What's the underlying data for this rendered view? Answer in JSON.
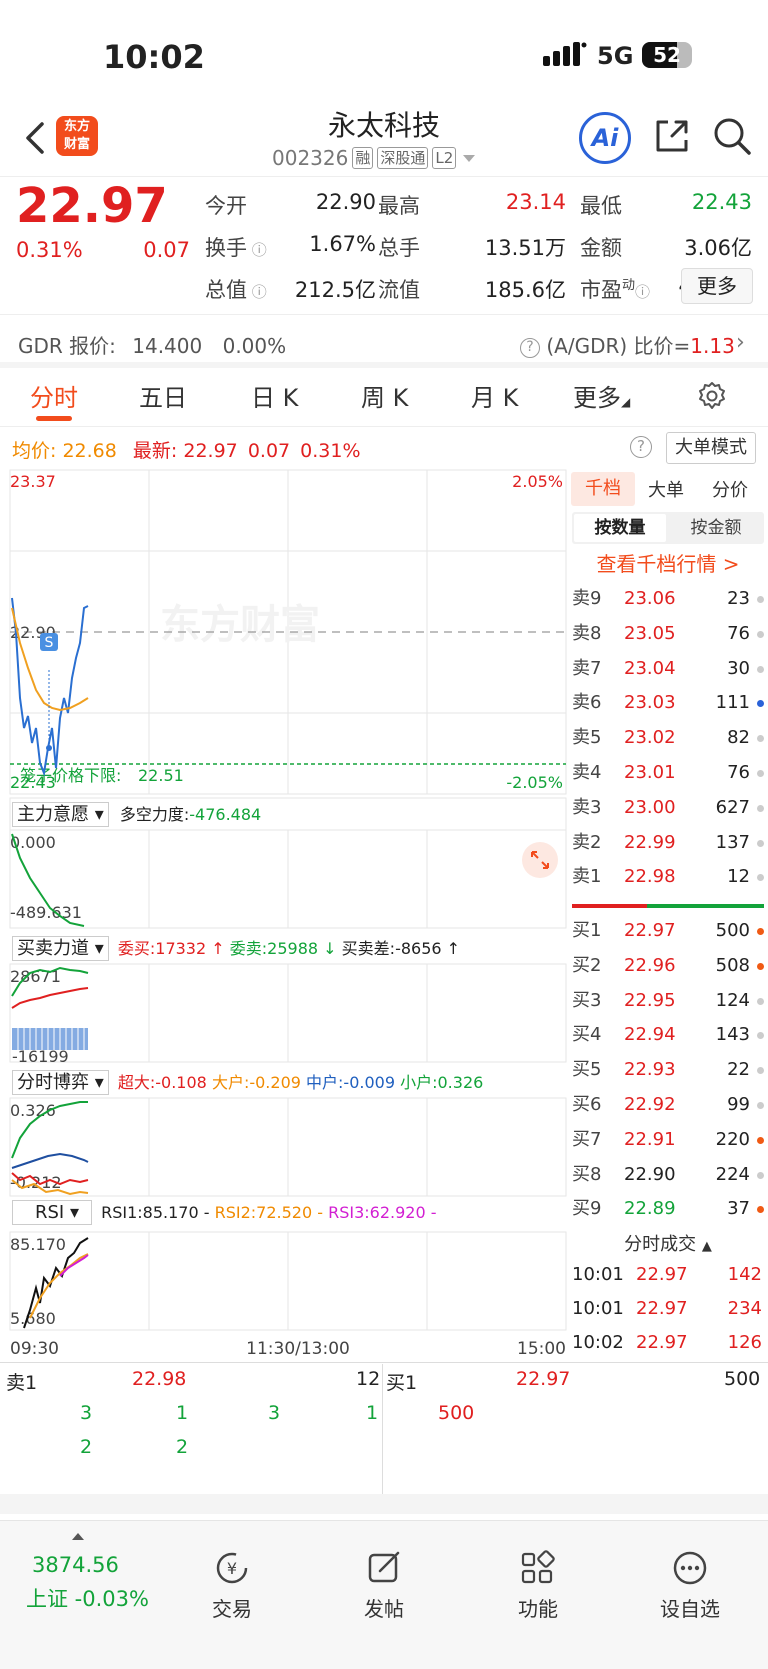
{
  "status": {
    "time": "10:02",
    "network": "5G",
    "battery": "52"
  },
  "header": {
    "logo_text": "东方\n财富",
    "name": "永太科技",
    "code": "002326",
    "tags": [
      "融",
      "深股通",
      "L2"
    ],
    "ai_label": "Ai"
  },
  "quote": {
    "price": "22.97",
    "change_pct": "0.31%",
    "change_amt": "0.07",
    "fields": [
      {
        "label": "今开",
        "value": "22.90",
        "color": "#222222"
      },
      {
        "label": "最高",
        "value": "23.14",
        "color": "#e02020"
      },
      {
        "label": "最低",
        "value": "22.43",
        "color": "#13a33a"
      },
      {
        "label": "换手",
        "value": "1.67%",
        "color": "#222222"
      },
      {
        "label": "总手",
        "value": "13.51万",
        "color": "#222222"
      },
      {
        "label": "金额",
        "value": "3.06亿",
        "color": "#222222"
      },
      {
        "label": "总值",
        "value": "212.5亿",
        "color": "#222222"
      },
      {
        "label": "流值",
        "value": "185.6亿",
        "color": "#222222"
      },
      {
        "label": "市盈",
        "value": "489.58",
        "color": "#222222"
      }
    ],
    "pe_sup": "动",
    "more_label": "更多"
  },
  "gdr": {
    "label": "GDR 报价:",
    "price": "14.400",
    "pct": "0.00%",
    "ratio_label": "(A/GDR) 比价=",
    "ratio": "1.13"
  },
  "tabs": [
    "分时",
    "五日",
    "日 K",
    "周 K",
    "月 K",
    "更多"
  ],
  "avg_row": {
    "avg_label": "均价:",
    "avg": "22.68",
    "last_label": "最新:",
    "last": "22.97",
    "chg": "0.07",
    "pct": "0.31%",
    "bigorder": "大单模式"
  },
  "chart": {
    "y_top": "23.37",
    "y_mid": "22.90",
    "y_low": "22.43",
    "pct_top": "2.05%",
    "pct_low": "-2.05%",
    "limit_label": "笼子价格下限:",
    "limit": "22.51",
    "watermark": "东方财富",
    "s_marker": "S"
  },
  "ind1": {
    "select": "主力意愿",
    "label": "多空力度:",
    "value": "-476.484",
    "top": "0.000",
    "bottom": "-489.631"
  },
  "ind2": {
    "select": "买卖力道",
    "buy_label": "委买:",
    "buy": "17332",
    "sell_label": "委卖:",
    "sell": "25988",
    "diff_label": "买卖差:",
    "diff": "-8656",
    "top": "28671",
    "bottom": "-16199"
  },
  "ind3": {
    "select": "分时博弈",
    "super_label": "超大:",
    "super": "-0.108",
    "big_label": "大户:",
    "big": "-0.209",
    "mid_label": "中户:",
    "mid": "-0.009",
    "small_label": "小户:",
    "small": "0.326",
    "top": "0.326",
    "bottom": "-0.212"
  },
  "ind4": {
    "select": "RSI",
    "rsi1": "RSI1:85.170 -",
    "rsi2": "RSI2:72.520 -",
    "rsi3": "RSI3:62.920 -",
    "top": "85.170",
    "bottom": "5.680"
  },
  "time_axis": [
    "09:30",
    "11:30/13:00",
    "15:00"
  ],
  "orderbook": {
    "tabs": [
      "千档",
      "大单",
      "分价"
    ],
    "toggle": [
      "按数量",
      "按金额"
    ],
    "link": "查看千档行情 >",
    "asks": [
      {
        "label": "卖9",
        "price": "23.06",
        "vol": "23",
        "dot": "#cccccc"
      },
      {
        "label": "卖8",
        "price": "23.05",
        "vol": "76",
        "dot": "#cccccc"
      },
      {
        "label": "卖7",
        "price": "23.04",
        "vol": "30",
        "dot": "#cccccc"
      },
      {
        "label": "卖6",
        "price": "23.03",
        "vol": "111",
        "dot": "#2a62d8"
      },
      {
        "label": "卖5",
        "price": "23.02",
        "vol": "82",
        "dot": "#cccccc"
      },
      {
        "label": "卖4",
        "price": "23.01",
        "vol": "76",
        "dot": "#cccccc"
      },
      {
        "label": "卖3",
        "price": "23.00",
        "vol": "627",
        "dot": "#cccccc"
      },
      {
        "label": "卖2",
        "price": "22.99",
        "vol": "137",
        "dot": "#cccccc"
      },
      {
        "label": "卖1",
        "price": "22.98",
        "vol": "12",
        "dot": "#cccccc"
      }
    ],
    "bids": [
      {
        "label": "买1",
        "price": "22.97",
        "vol": "500",
        "dot": "#f05a14",
        "pc": "#e02020"
      },
      {
        "label": "买2",
        "price": "22.96",
        "vol": "508",
        "dot": "#f05a14",
        "pc": "#e02020"
      },
      {
        "label": "买3",
        "price": "22.95",
        "vol": "124",
        "dot": "#cccccc",
        "pc": "#e02020"
      },
      {
        "label": "买4",
        "price": "22.94",
        "vol": "143",
        "dot": "#cccccc",
        "pc": "#e02020"
      },
      {
        "label": "买5",
        "price": "22.93",
        "vol": "22",
        "dot": "#cccccc",
        "pc": "#e02020"
      },
      {
        "label": "买6",
        "price": "22.92",
        "vol": "99",
        "dot": "#cccccc",
        "pc": "#e02020"
      },
      {
        "label": "买7",
        "price": "22.91",
        "vol": "220",
        "dot": "#f05a14",
        "pc": "#e02020"
      },
      {
        "label": "买8",
        "price": "22.90",
        "vol": "224",
        "dot": "#cccccc",
        "pc": "#222222"
      },
      {
        "label": "买9",
        "price": "22.89",
        "vol": "37",
        "dot": "#f05a14",
        "pc": "#13a33a"
      }
    ],
    "ticks_header": "分时成交",
    "ticks": [
      {
        "time": "10:01",
        "price": "22.97",
        "vol": "142"
      },
      {
        "time": "10:01",
        "price": "22.97",
        "vol": "234"
      },
      {
        "time": "10:02",
        "price": "22.97",
        "vol": "126"
      }
    ]
  },
  "bottom_book": {
    "ask1_label": "卖1",
    "ask1_price": "22.98",
    "ask1_vol": "12",
    "bid1_label": "买1",
    "bid1_price": "22.97",
    "bid1_vol": "500",
    "ask_queue_row1": [
      "3",
      "1",
      "3",
      "1"
    ],
    "ask_queue_row2": [
      "2",
      "2"
    ],
    "bid_queue": [
      "500"
    ]
  },
  "bottom_bar": {
    "index_value": "3874.56",
    "index_name": "上证 -0.03%",
    "items": [
      "交易",
      "发帖",
      "功能",
      "设自选"
    ]
  }
}
